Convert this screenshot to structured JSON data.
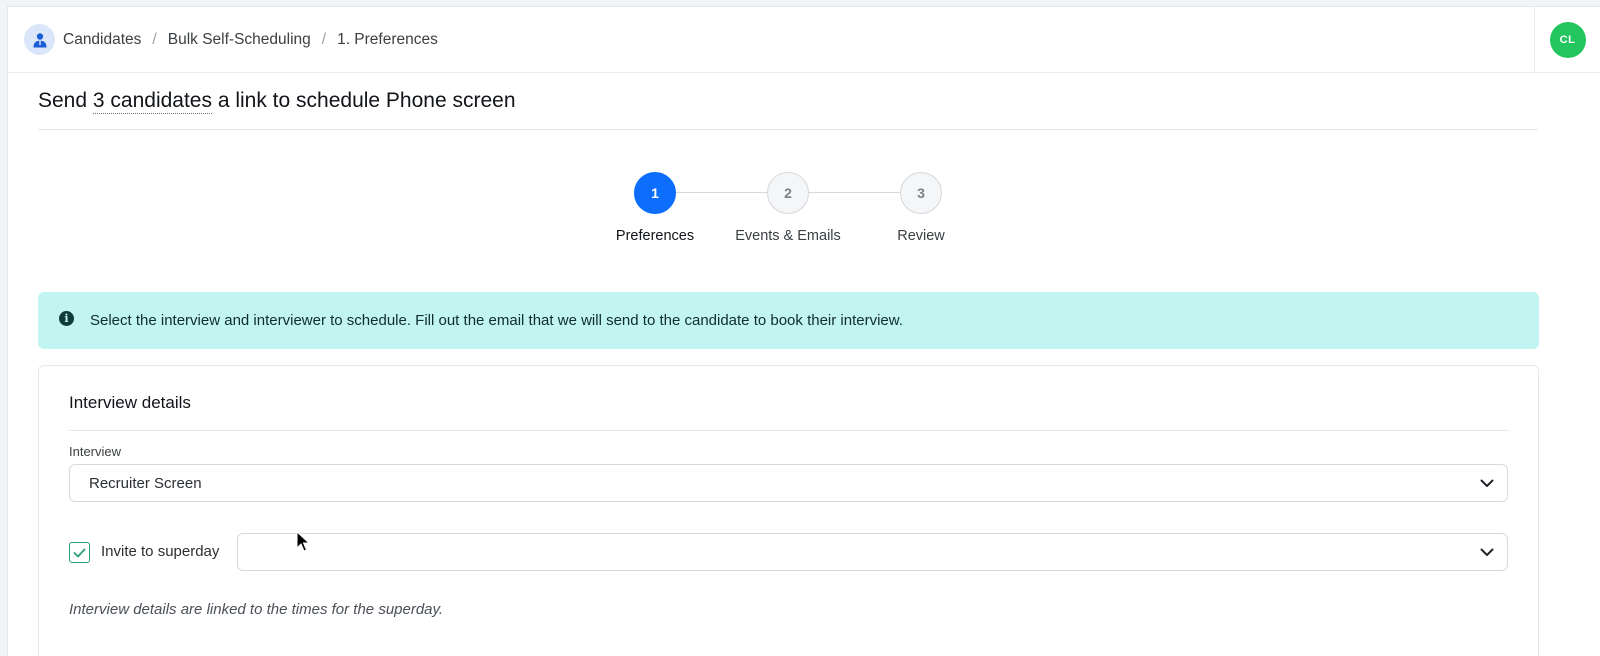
{
  "breadcrumb": {
    "items": [
      "Candidates",
      "Bulk Self-Scheduling",
      "1. Preferences"
    ],
    "separator": "/"
  },
  "user": {
    "initials": "CL",
    "avatar_color": "#22c55e"
  },
  "title": {
    "prefix": "Send ",
    "candidates_link": "3 candidates",
    "suffix": " a link to schedule Phone screen"
  },
  "steps": [
    {
      "number": "1",
      "label": "Preferences",
      "active": true
    },
    {
      "number": "2",
      "label": "Events & Emails",
      "active": false
    },
    {
      "number": "3",
      "label": "Review",
      "active": false
    }
  ],
  "alert": {
    "icon": "info-icon",
    "text": "Select the interview and interviewer to schedule. Fill out the email that we will send to the candidate to book their interview."
  },
  "interview_details": {
    "heading": "Interview details",
    "interview_label": "Interview",
    "interview_value": "Recruiter Screen",
    "superday_label": "Invite to superday",
    "superday_checked": true,
    "superday_value": "",
    "helper_text": "Interview details are linked to the times for the superday."
  },
  "colors": {
    "primary": "#0d6efd",
    "alert_bg": "#c2f4f1",
    "check": "#2e9e79"
  }
}
